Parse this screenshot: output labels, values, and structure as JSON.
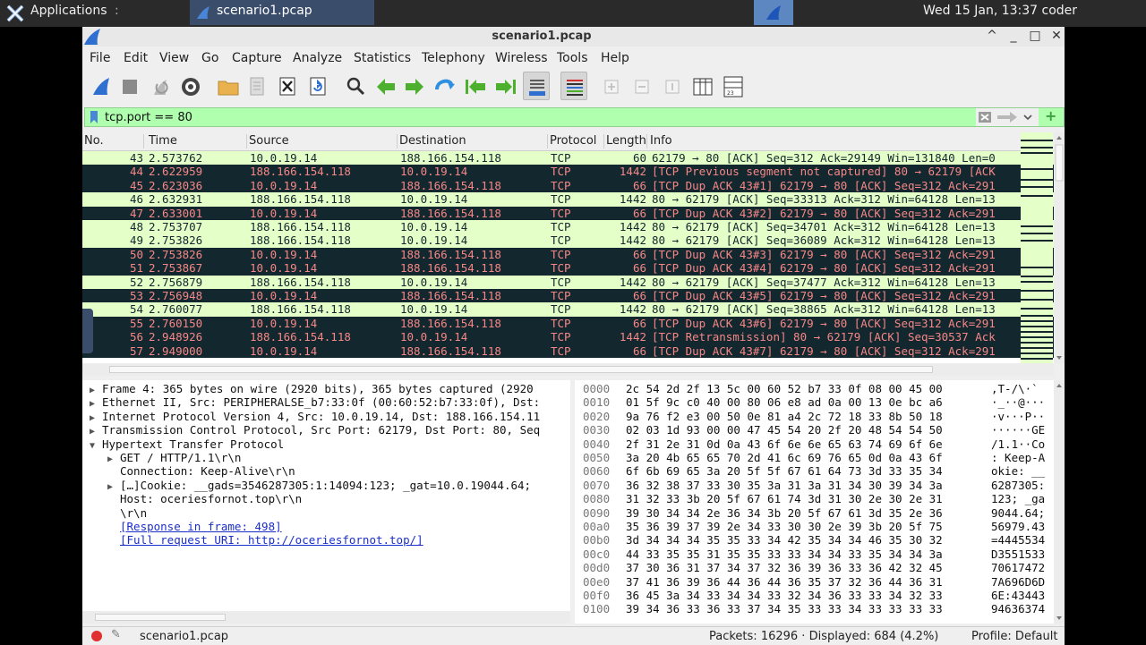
{
  "taskbar": {
    "apps_label": "Applications",
    "separator": ":",
    "task_label": "scenario1.pcap",
    "clock": "Wed 15 Jan, 13:37 coder"
  },
  "window": {
    "title": "scenario1.pcap",
    "controls": [
      "^",
      "_",
      "□",
      "✕"
    ]
  },
  "menu": [
    {
      "label": "File"
    },
    {
      "label": "Edit"
    },
    {
      "label": "View"
    },
    {
      "label": "Go"
    },
    {
      "label": "Capture"
    },
    {
      "label": "Analyze"
    },
    {
      "label": "Statistics"
    },
    {
      "label": "Telephony"
    },
    {
      "label": "Wireless"
    },
    {
      "label": "Tools"
    },
    {
      "label": "Help"
    }
  ],
  "filter": {
    "value": "tcp.port == 80"
  },
  "packet_list": {
    "columns": [
      "No.",
      "Time",
      "Source",
      "Destination",
      "Protocol",
      "Length",
      "Info"
    ],
    "rows": [
      {
        "no": "43",
        "time": "2.573762",
        "src": "10.0.19.14",
        "dst": "188.166.154.118",
        "proto": "TCP",
        "len": "60",
        "info": "62179 → 80 [ACK] Seq=312 Ack=29149 Win=131840 Len=0",
        "style": "green"
      },
      {
        "no": "44",
        "time": "2.622959",
        "src": "188.166.154.118",
        "dst": "10.0.19.14",
        "proto": "TCP",
        "len": "1442",
        "info": "[TCP Previous segment not captured] 80 → 62179 [ACK",
        "style": "black"
      },
      {
        "no": "45",
        "time": "2.623036",
        "src": "10.0.19.14",
        "dst": "188.166.154.118",
        "proto": "TCP",
        "len": "66",
        "info": "[TCP Dup ACK 43#1] 62179 → 80 [ACK] Seq=312 Ack=291",
        "style": "black"
      },
      {
        "no": "46",
        "time": "2.632931",
        "src": "188.166.154.118",
        "dst": "10.0.19.14",
        "proto": "TCP",
        "len": "1442",
        "info": "80 → 62179 [ACK] Seq=33313 Ack=312 Win=64128 Len=13",
        "style": "green"
      },
      {
        "no": "47",
        "time": "2.633001",
        "src": "10.0.19.14",
        "dst": "188.166.154.118",
        "proto": "TCP",
        "len": "66",
        "info": "[TCP Dup ACK 43#2] 62179 → 80 [ACK] Seq=312 Ack=291",
        "style": "black"
      },
      {
        "no": "48",
        "time": "2.753707",
        "src": "188.166.154.118",
        "dst": "10.0.19.14",
        "proto": "TCP",
        "len": "1442",
        "info": "80 → 62179 [ACK] Seq=34701 Ack=312 Win=64128 Len=13",
        "style": "green"
      },
      {
        "no": "49",
        "time": "2.753826",
        "src": "188.166.154.118",
        "dst": "10.0.19.14",
        "proto": "TCP",
        "len": "1442",
        "info": "80 → 62179 [ACK] Seq=36089 Ack=312 Win=64128 Len=13",
        "style": "green"
      },
      {
        "no": "50",
        "time": "2.753826",
        "src": "10.0.19.14",
        "dst": "188.166.154.118",
        "proto": "TCP",
        "len": "66",
        "info": "[TCP Dup ACK 43#3] 62179 → 80 [ACK] Seq=312 Ack=291",
        "style": "black"
      },
      {
        "no": "51",
        "time": "2.753867",
        "src": "10.0.19.14",
        "dst": "188.166.154.118",
        "proto": "TCP",
        "len": "66",
        "info": "[TCP Dup ACK 43#4] 62179 → 80 [ACK] Seq=312 Ack=291",
        "style": "black"
      },
      {
        "no": "52",
        "time": "2.756879",
        "src": "188.166.154.118",
        "dst": "10.0.19.14",
        "proto": "TCP",
        "len": "1442",
        "info": "80 → 62179 [ACK] Seq=37477 Ack=312 Win=64128 Len=13",
        "style": "green"
      },
      {
        "no": "53",
        "time": "2.756948",
        "src": "10.0.19.14",
        "dst": "188.166.154.118",
        "proto": "TCP",
        "len": "66",
        "info": "[TCP Dup ACK 43#5] 62179 → 80 [ACK] Seq=312 Ack=291",
        "style": "black"
      },
      {
        "no": "54",
        "time": "2.760077",
        "src": "188.166.154.118",
        "dst": "10.0.19.14",
        "proto": "TCP",
        "len": "1442",
        "info": "80 → 62179 [ACK] Seq=38865 Ack=312 Win=64128 Len=13",
        "style": "green"
      },
      {
        "no": "55",
        "time": "2.760150",
        "src": "10.0.19.14",
        "dst": "188.166.154.118",
        "proto": "TCP",
        "len": "66",
        "info": "[TCP Dup ACK 43#6] 62179 → 80 [ACK] Seq=312 Ack=291",
        "style": "black"
      },
      {
        "no": "56",
        "time": "2.948926",
        "src": "188.166.154.118",
        "dst": "10.0.19.14",
        "proto": "TCP",
        "len": "1442",
        "info": "[TCP Retransmission] 80 → 62179 [ACK] Seq=30537 Ack",
        "style": "black"
      },
      {
        "no": "57",
        "time": "2.949000",
        "src": "10.0.19.14",
        "dst": "188.166.154.118",
        "proto": "TCP",
        "len": "66",
        "info": "[TCP Dup ACK 43#7] 62179 → 80 [ACK] Seq=312 Ack=291",
        "style": "black"
      }
    ]
  },
  "details": [
    {
      "indent": 0,
      "arrow": "▶",
      "text": "Frame 4: 365 bytes on wire (2920 bits), 365 bytes captured (2920",
      "link": false
    },
    {
      "indent": 0,
      "arrow": "▶",
      "text": "Ethernet II, Src: PERIPHERALSE_b7:33:0f (00:60:52:b7:33:0f), Dst:",
      "link": false
    },
    {
      "indent": 0,
      "arrow": "▶",
      "text": "Internet Protocol Version 4, Src: 10.0.19.14, Dst: 188.166.154.11",
      "link": false
    },
    {
      "indent": 0,
      "arrow": "▶",
      "text": "Transmission Control Protocol, Src Port: 62179, Dst Port: 80, Seq",
      "link": false
    },
    {
      "indent": 0,
      "arrow": "▼",
      "text": "Hypertext Transfer Protocol",
      "link": false
    },
    {
      "indent": 1,
      "arrow": "▶",
      "text": "GET / HTTP/1.1\\r\\n",
      "link": false
    },
    {
      "indent": 1,
      "arrow": "",
      "text": "Connection: Keep-Alive\\r\\n",
      "link": false
    },
    {
      "indent": 1,
      "arrow": "▶",
      "text": "[…]Cookie: __gads=3546287305:1:14094:123; _gat=10.0.19044.64;",
      "link": false
    },
    {
      "indent": 1,
      "arrow": "",
      "text": "Host: oceriesfornot.top\\r\\n",
      "link": false
    },
    {
      "indent": 1,
      "arrow": "",
      "text": "\\r\\n",
      "link": false
    },
    {
      "indent": 1,
      "arrow": "",
      "text": "[Response in frame: 498]",
      "link": true
    },
    {
      "indent": 1,
      "arrow": "",
      "text": "[Full request URI: http://oceriesfornot.top/]",
      "link": true
    }
  ],
  "hex": [
    {
      "off": "0000",
      "bytes": "2c 54 2d 2f 13 5c 00 60  52 b7 33 0f 08 00 45 00",
      "ascii": ",T-/\\·`"
    },
    {
      "off": "0010",
      "bytes": "01 5f 9c c0 40 00 80 06  e8 ad 0a 00 13 0e bc a6",
      "ascii": "·_··@···"
    },
    {
      "off": "0020",
      "bytes": "9a 76 f2 e3 00 50 0e 81  a4 2c 72 18 33 8b 50 18",
      "ascii": "·v···P··"
    },
    {
      "off": "0030",
      "bytes": "02 03 1d 93 00 00 47 45  54 20 2f 20 48 54 54 50",
      "ascii": "······GE"
    },
    {
      "off": "0040",
      "bytes": "2f 31 2e 31 0d 0a 43 6f  6e 6e 65 63 74 69 6f 6e",
      "ascii": "/1.1··Co"
    },
    {
      "off": "0050",
      "bytes": "3a 20 4b 65 65 70 2d 41  6c 69 76 65 0d 0a 43 6f",
      "ascii": ": Keep-A"
    },
    {
      "off": "0060",
      "bytes": "6f 6b 69 65 3a 20 5f 5f  67 61 64 73 3d 33 35 34",
      "ascii": "okie: __"
    },
    {
      "off": "0070",
      "bytes": "36 32 38 37 33 30 35 3a  31 3a 31 34 30 39 34 3a",
      "ascii": "6287305:"
    },
    {
      "off": "0080",
      "bytes": "31 32 33 3b 20 5f 67 61  74 3d 31 30 2e 30 2e 31",
      "ascii": "123; _ga"
    },
    {
      "off": "0090",
      "bytes": "39 30 34 34 2e 36 34 3b  20 5f 67 61 3d 35 2e 36",
      "ascii": "9044.64;"
    },
    {
      "off": "00a0",
      "bytes": "35 36 39 37 39 2e 34 33  30 30 2e 39 3b 20 5f 75",
      "ascii": "56979.43"
    },
    {
      "off": "00b0",
      "bytes": "3d 34 34 34 35 35 33 34  42 35 34 34 46 35 30 32",
      "ascii": "=4445534"
    },
    {
      "off": "00c0",
      "bytes": "44 33 35 35 31 35 35 33  33 34 34 33 35 34 34 3a",
      "ascii": "D3551533"
    },
    {
      "off": "00d0",
      "bytes": "37 30 36 31 37 34 37 32  36 39 36 33 36 42 32 45",
      "ascii": "70617472"
    },
    {
      "off": "00e0",
      "bytes": "37 41 36 39 36 44 36 44  36 35 37 32 36 44 36 31",
      "ascii": "7A696D6D"
    },
    {
      "off": "00f0",
      "bytes": "36 45 3a 34 33 34 34 33  32 34 36 33 33 34 32 33",
      "ascii": "6E:43443"
    },
    {
      "off": "0100",
      "bytes": "39 34 36 33 36 33 37 34  35 33 33 34 33 33 33 33",
      "ascii": "94636374"
    }
  ],
  "status": {
    "file": "scenario1.pcap",
    "packets": "Packets: 16296 · Displayed: 684 (4.2%)",
    "profile": "Profile: Default"
  }
}
